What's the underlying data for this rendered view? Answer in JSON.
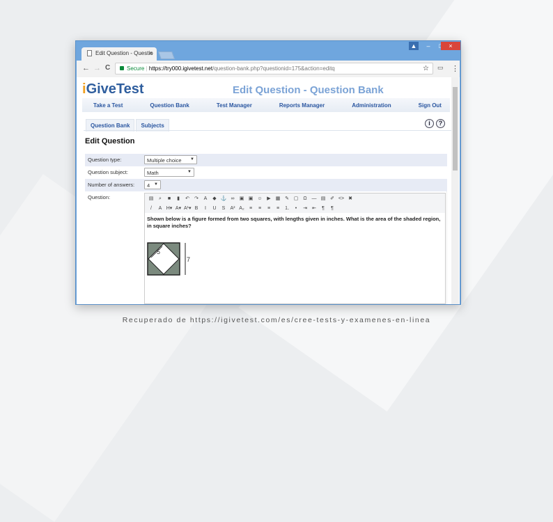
{
  "browser": {
    "tab_title": "Edit Question - Questio",
    "tab_close": "×",
    "secure_label": "Secure",
    "url_host": "https://try000.igivetest.net",
    "url_path": "/question-bank.php?questionid=175&action=editq",
    "back": "←",
    "forward": "→",
    "reload": "C",
    "star": "☆",
    "menu": "⋮",
    "cast": "▭",
    "minimize": "–",
    "maximize": "□",
    "close": "×",
    "profile": "👤"
  },
  "header": {
    "logo_i": "i",
    "logo_rest": "GiveTest",
    "page_title": "Edit Question - Question Bank"
  },
  "menu": [
    "Take a Test",
    "Question Bank",
    "Test Manager",
    "Reports Manager",
    "Administration",
    "Sign Out"
  ],
  "subtabs": [
    "Question Bank",
    "Subjects"
  ],
  "help": {
    "info": "i",
    "question": "?"
  },
  "form": {
    "heading": "Edit Question",
    "rows": [
      {
        "label": "Question type:",
        "value": "Multiple choice"
      },
      {
        "label": "Question subject:",
        "value": "Math"
      },
      {
        "label": "Number of answers:",
        "value": "4"
      },
      {
        "label": "Question:"
      }
    ]
  },
  "editor": {
    "toolbar1": [
      "source-icon",
      "find-icon",
      "print-icon",
      "paste-icon",
      "undo-icon",
      "redo-icon",
      "text-color-icon",
      "bg-color-icon",
      "anchor-icon",
      "link-icon",
      "image-icon",
      "flash-icon",
      "emoji-icon",
      "youtube-icon",
      "table-icon",
      "edit-icon",
      "frame-icon",
      "omega-icon",
      "hr-icon",
      "template-icon",
      "eraser-icon",
      "html-icon",
      "remove-icon"
    ],
    "toolbar1_glyphs": [
      "▤",
      "⌕",
      "■",
      "▮",
      "↶",
      "↷",
      "A",
      "◆",
      "⚓",
      "∞",
      "▣",
      "▣",
      "☺",
      "▶",
      "▦",
      "✎",
      "▢",
      "Ω",
      "—",
      "▤",
      "✐",
      "<>",
      "✖"
    ],
    "toolbar2": [
      "pen-icon",
      "style-icon",
      "heading-icon",
      "font-icon",
      "font-size-icon",
      "bold-icon",
      "italic-icon",
      "underline-icon",
      "strike-icon",
      "superscript-icon",
      "subscript-icon",
      "align-left-icon",
      "align-center-icon",
      "align-right-icon",
      "justify-icon",
      "ordered-list-icon",
      "unordered-list-icon",
      "indent-icon",
      "outdent-icon",
      "ltr-icon",
      "rtl-icon"
    ],
    "toolbar2_glyphs": [
      "/",
      "A",
      "H▾",
      "A▾",
      "A¹▾",
      "B",
      "I",
      "U",
      "S",
      "A²",
      "A₂",
      "≡",
      "≡",
      "≡",
      "≡",
      "⒈",
      "•",
      "⇥",
      "⇤",
      "¶",
      "¶"
    ],
    "question_text": "Shown below is a figure formed from two squares, with lengths given in inches. What is the area of the shaded region, in square inches?",
    "figure": {
      "inner_label": "5",
      "outer_label": "7",
      "shade_color": "#7b8a7e"
    }
  },
  "caption": "Recuperado de https://igivetest.com/es/cree-tests-y-examenes-en-linea"
}
